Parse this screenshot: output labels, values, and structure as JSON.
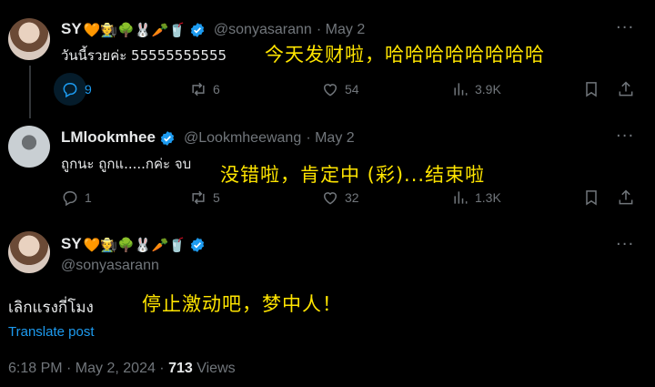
{
  "tweet1": {
    "display_name": "SY",
    "name_emojis": [
      "🧡",
      "🧑‍🌾",
      "🌳",
      "🐰",
      "🥕",
      "🥤"
    ],
    "handle": "@sonyasarann",
    "date": "May 2",
    "text": "วันนี้รวยค่ะ 55555555555",
    "overlay": "今天发财啦，哈哈哈哈哈哈哈哈",
    "stats": {
      "replies": "9",
      "reposts": "6",
      "likes": "54",
      "views": "3.9K"
    },
    "more": "···"
  },
  "tweet2": {
    "display_name": "LMlookmhee",
    "handle": "@Lookmheewang",
    "date": "May 2",
    "text": "ถูกนะ ถูกแ.....กค่ะ จบ",
    "overlay": "没错啦，肯定中 (彩)...结束啦",
    "stats": {
      "replies": "1",
      "reposts": "5",
      "likes": "32",
      "views": "1.3K"
    },
    "more": "···"
  },
  "tweet3": {
    "display_name": "SY",
    "handle": "@sonyasarann",
    "text": "เลิกแรงกี่โมง",
    "overlay": "停止激动吧，梦中人！",
    "translate": "Translate post",
    "time": "6:18 PM · May 2, 2024 · ",
    "views_count": "713",
    "views_label": " Views",
    "more": "···"
  },
  "colors": {
    "accent": "#1d9bf0",
    "muted": "#71767b",
    "overlay": "#ffe500",
    "bg": "#000000"
  }
}
